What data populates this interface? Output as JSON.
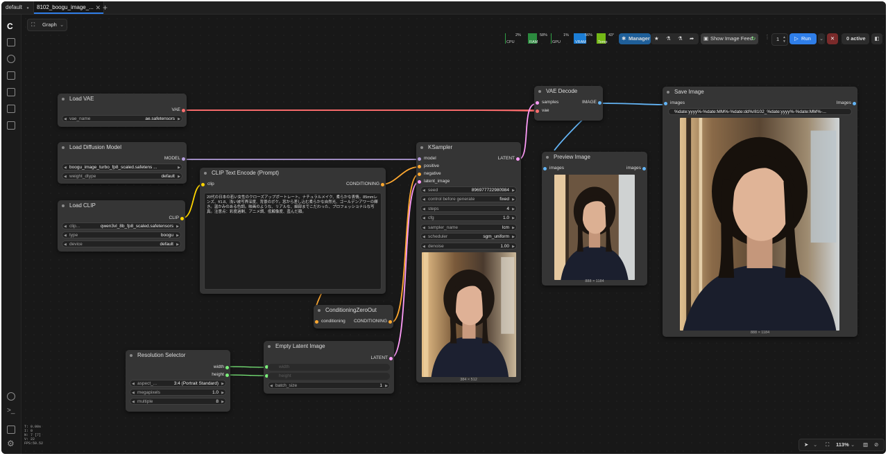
{
  "tabs": [
    {
      "label": "default"
    },
    {
      "label": "8102_boogu_image_..."
    }
  ],
  "toolbar": {
    "graph_label": "Graph",
    "metrics": [
      {
        "label": "CPU",
        "value": "2%",
        "color": "#2f9e44"
      },
      {
        "label": "RAM",
        "value": "58%",
        "color": "#2f9e44"
      },
      {
        "label": "GPU",
        "value": "1%",
        "color": "#2f9e44"
      },
      {
        "label": "VRAM",
        "value": "56%",
        "color": "#1c7ed6"
      },
      {
        "label": "Temp",
        "value": "43°",
        "color": "#74b816"
      }
    ],
    "manager_label": "Manager",
    "show_feed_label": "Show Image Feed",
    "queue_count": "1",
    "run_label": "Run",
    "active_label": "0 active"
  },
  "stats": {
    "t": "T: 0.00s",
    "i": "I: 0",
    "n": "N: 7 [7]",
    "v": "V: 22",
    "fps": "FPS:59.52"
  },
  "bottom": {
    "zoom": "113%"
  },
  "nodes": {
    "load_vae": {
      "title": "Load VAE",
      "out": "VAE",
      "w_name": "vae_name",
      "w_value": "ae.safetensors"
    },
    "load_diffusion": {
      "title": "Load Diffusion Model",
      "out": "MODEL",
      "w1_value": "boogu_image_turbo_fp8_scaled.safetens ...",
      "w2_name": "weight_dtype",
      "w2_value": "default"
    },
    "load_clip": {
      "title": "Load CLIP",
      "out": "CLIP",
      "w1_name": "clip...",
      "w1_value": "qwen3vl_8b_fp8_scaled.safetensors",
      "w2_name": "type",
      "w2_value": "boogu",
      "w3_name": "device",
      "w3_value": "default"
    },
    "clip_text": {
      "title": "CLIP Text Encode (Prompt)",
      "in": "clip",
      "out": "CONDITIONING",
      "prompt": "20代の日本の若い女性のクローズアップポートレート。ナチュラルメイク、柔らかな表情。85mmレンズ、f/1.8、浅い被写界深度、背景のボケ。窓から差し込む柔らかな自然光、ゴールデンアワーの輝き。温かみのある色調。映画のような、リアルな、細部までこだわった、プロフェッショナルな写真。注意点：彩度過剰、アニメ調、低解像度、歪んだ顔。"
    },
    "cond_zero": {
      "title": "ConditioningZeroOut",
      "in": "conditioning",
      "out": "CONDITIONING"
    },
    "resolution": {
      "title": "Resolution Selector",
      "out1": "width",
      "out2": "height",
      "w1_name": "aspect_...",
      "w1_value": "3:4 (Portrait Standard)",
      "w2_name": "megapixels",
      "w2_value": "1.0",
      "w3_name": "multiple",
      "w3_value": "8"
    },
    "empty_latent": {
      "title": "Empty Latent Image",
      "out": "LATENT",
      "ph1": "width",
      "ph2": "height",
      "w_name": "batch_size",
      "w_value": "1"
    },
    "ksampler": {
      "title": "KSampler",
      "in1": "model",
      "in2": "positive",
      "in3": "negative",
      "in4": "latent_image",
      "out": "LATENT",
      "widgets": [
        {
          "name": "seed",
          "value": "896977722980984"
        },
        {
          "name": "control before generate",
          "value": "fixed"
        },
        {
          "name": "steps",
          "value": "4"
        },
        {
          "name": "cfg",
          "value": "1.0"
        },
        {
          "name": "sampler_name",
          "value": "lcm"
        },
        {
          "name": "scheduler",
          "value": "sgm_uniform"
        },
        {
          "name": "denoise",
          "value": "1.00"
        }
      ],
      "caption": "384 × 512"
    },
    "vae_decode": {
      "title": "VAE Decode",
      "in1": "samples",
      "in2": "vae",
      "out": "IMAGE"
    },
    "preview": {
      "title": "Preview Image",
      "in": "images",
      "out": "images",
      "caption": "888 × 1184"
    },
    "save": {
      "title": "Save Image",
      "in": "images",
      "out": "Images",
      "filename": "%date:yyyy%-%date:MM%-%date:dd%/8102_%date:yyyy%-%date:MM%-...",
      "caption": "888 × 1184"
    }
  },
  "colors": {
    "vae": "#ff6e6e",
    "model": "#b39ddb",
    "clip": "#ffd500",
    "conditioning": "#ffa931",
    "latent": "#ff9cf9",
    "image": "#64b5f6",
    "int": "#7bf07b",
    "accent": "#2f7ee8"
  }
}
